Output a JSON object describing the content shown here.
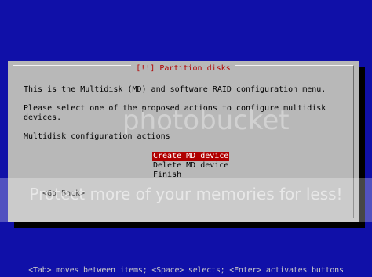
{
  "dialog": {
    "title": "[!!] Partition disks",
    "intro": "This is the Multidisk (MD) and software RAID configuration menu.",
    "instruction_line1": "Please select one of the proposed actions to configure multidisk",
    "instruction_line2": "devices.",
    "menu_heading": "Multidisk configuration actions",
    "menu_items": [
      {
        "label": "Create MD device",
        "selected": true
      },
      {
        "label": "Delete MD device",
        "selected": false
      },
      {
        "label": "Finish",
        "selected": false
      }
    ],
    "go_back_label": "<Go Back>"
  },
  "status_bar": {
    "text": "<Tab> moves between items; <Space> selects; <Enter> activates buttons"
  },
  "watermark": {
    "logo_text": "photobucket",
    "tagline": "Protect more of your memories for less!"
  },
  "colors": {
    "background": "#1010a8",
    "dialog": "#b8b8b8",
    "title_text": "#b00000",
    "selection": "#b00000",
    "selection_text": "#ffffff",
    "status_text": "#c8c8c8"
  }
}
